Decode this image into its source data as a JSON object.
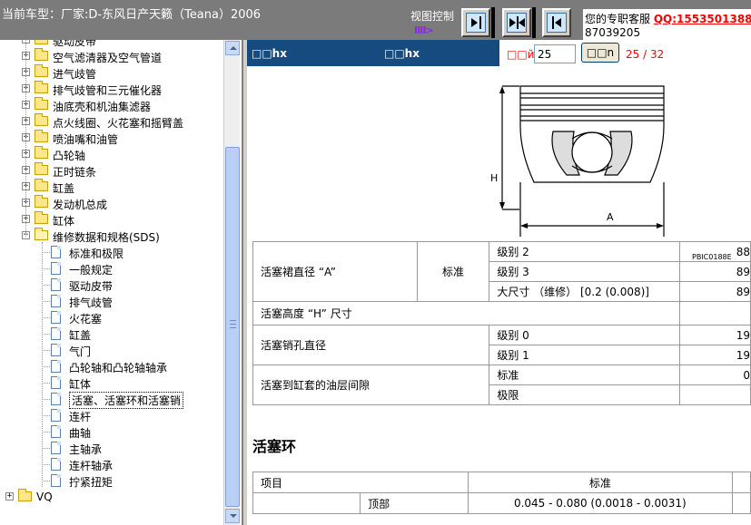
{
  "topbar": {
    "car_title": "当前车型：厂家:D-东风日产天籁（Teana）2006",
    "view_control_label": "视图控制",
    "view_control_arrow": "ⅡII>",
    "support_text": "您的专职客服 ",
    "support_qq": "QQ:1553501388",
    "support_phone": "87039205"
  },
  "tree": {
    "items": [
      {
        "label": "驱动皮带",
        "type": "folder",
        "level": 1,
        "expander": "+"
      },
      {
        "label": "空气滤清器及空气管道",
        "type": "folder",
        "level": 1,
        "expander": "+"
      },
      {
        "label": "进气歧管",
        "type": "folder",
        "level": 1,
        "expander": "+"
      },
      {
        "label": "排气歧管和三元催化器",
        "type": "folder",
        "level": 1,
        "expander": "+"
      },
      {
        "label": "油底壳和机油集滤器",
        "type": "folder",
        "level": 1,
        "expander": "+"
      },
      {
        "label": "点火线圈、火花塞和摇臂盖",
        "type": "folder",
        "level": 1,
        "expander": "+"
      },
      {
        "label": "喷油嘴和油管",
        "type": "folder",
        "level": 1,
        "expander": "+"
      },
      {
        "label": "凸轮轴",
        "type": "folder",
        "level": 1,
        "expander": "+"
      },
      {
        "label": "正时链条",
        "type": "folder",
        "level": 1,
        "expander": "+"
      },
      {
        "label": "缸盖",
        "type": "folder",
        "level": 1,
        "expander": "+"
      },
      {
        "label": "发动机总成",
        "type": "folder",
        "level": 1,
        "expander": "+"
      },
      {
        "label": " 缸体",
        "type": "folder",
        "level": 1,
        "expander": "+"
      },
      {
        "label": "维修数据和规格(SDS)",
        "type": "folder-open",
        "level": 1,
        "expander": "−"
      },
      {
        "label": "标准和极限",
        "type": "doc",
        "level": 2
      },
      {
        "label": "一般规定",
        "type": "doc",
        "level": 2
      },
      {
        "label": "驱动皮带",
        "type": "doc",
        "level": 2
      },
      {
        "label": "排气歧管",
        "type": "doc",
        "level": 2
      },
      {
        "label": "火花塞",
        "type": "doc",
        "level": 2
      },
      {
        "label": "缸盖",
        "type": "doc",
        "level": 2
      },
      {
        "label": "气门",
        "type": "doc",
        "level": 2
      },
      {
        "label": "凸轮轴和凸轮轴轴承",
        "type": "doc",
        "level": 2
      },
      {
        "label": " 缸体",
        "type": "doc",
        "level": 2
      },
      {
        "label": "活塞、活塞环和活塞销",
        "type": "doc",
        "level": 2,
        "selected": true
      },
      {
        "label": "连杆",
        "type": "doc",
        "level": 2
      },
      {
        "label": "曲轴",
        "type": "doc",
        "level": 2
      },
      {
        "label": "主轴承",
        "type": "doc",
        "level": 2
      },
      {
        "label": "连杆轴承",
        "type": "doc",
        "level": 2
      },
      {
        "label": "拧紧扭矩",
        "type": "doc",
        "level": 2
      },
      {
        "label": "VQ",
        "type": "folder",
        "level": 0,
        "expander": "+"
      }
    ]
  },
  "content": {
    "header_link_1": "□□hx",
    "header_link_2": "□□hx",
    "page_label": "□□й",
    "page_value": "25",
    "go_label": "□□n",
    "page_count": "25 / 32",
    "diagram_code": "PBIC0188E",
    "diagram_label_h": "H",
    "diagram_label_a": "A",
    "spec_rows": {
      "skirt_label": "活塞裙直径 “A”",
      "standard": "标准",
      "grade2": "级别 2",
      "grade2_val": "88",
      "grade3": "级别 3",
      "grade3_val": "89",
      "oversize": "大尺寸 （维修） [0.2 (0.008)]",
      "oversize_val": "89",
      "height_label": "活塞高度 “H” 尺寸",
      "pin_label": "活塞销孔直径",
      "grade0": "级别 0",
      "grade0_val": "19",
      "grade1": "级别 1",
      "grade1_val": "19",
      "clearance_label": "活塞到缸套的油层间隙",
      "clear_std": "标准",
      "clear_std_val": "0",
      "clear_limit": "极限"
    },
    "ring_title": "活塞环",
    "ring_table": {
      "col_item": "项目",
      "col_standard": "标准",
      "row_top": "顶部",
      "row_top_val": "0.045 - 0.080 (0.0018 - 0.0031)"
    }
  }
}
